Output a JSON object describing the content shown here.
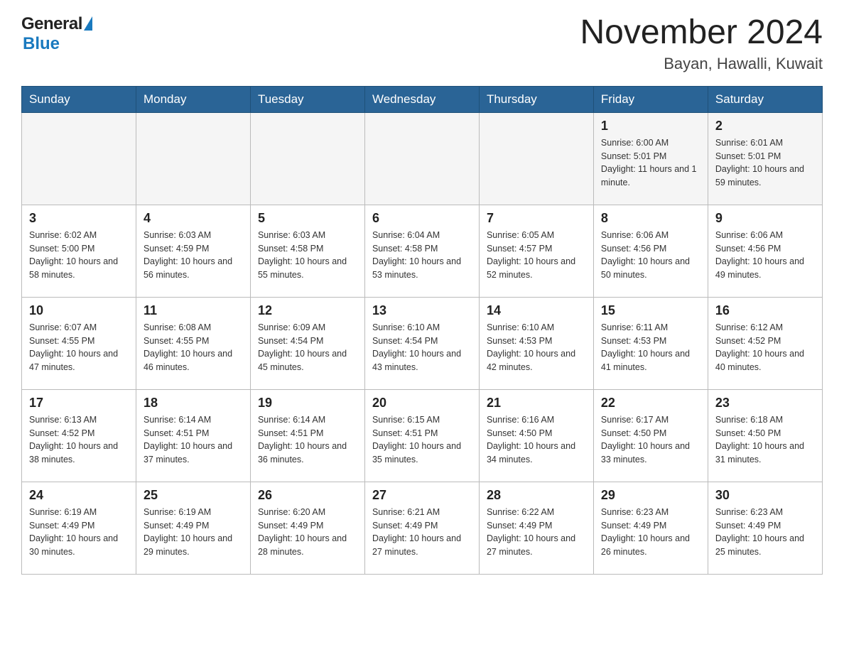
{
  "header": {
    "logo_general": "General",
    "logo_blue": "Blue",
    "title": "November 2024",
    "subtitle": "Bayan, Hawalli, Kuwait"
  },
  "weekdays": [
    "Sunday",
    "Monday",
    "Tuesday",
    "Wednesday",
    "Thursday",
    "Friday",
    "Saturday"
  ],
  "weeks": [
    [
      {
        "day": "",
        "info": ""
      },
      {
        "day": "",
        "info": ""
      },
      {
        "day": "",
        "info": ""
      },
      {
        "day": "",
        "info": ""
      },
      {
        "day": "",
        "info": ""
      },
      {
        "day": "1",
        "info": "Sunrise: 6:00 AM\nSunset: 5:01 PM\nDaylight: 11 hours and 1 minute."
      },
      {
        "day": "2",
        "info": "Sunrise: 6:01 AM\nSunset: 5:01 PM\nDaylight: 10 hours and 59 minutes."
      }
    ],
    [
      {
        "day": "3",
        "info": "Sunrise: 6:02 AM\nSunset: 5:00 PM\nDaylight: 10 hours and 58 minutes."
      },
      {
        "day": "4",
        "info": "Sunrise: 6:03 AM\nSunset: 4:59 PM\nDaylight: 10 hours and 56 minutes."
      },
      {
        "day": "5",
        "info": "Sunrise: 6:03 AM\nSunset: 4:58 PM\nDaylight: 10 hours and 55 minutes."
      },
      {
        "day": "6",
        "info": "Sunrise: 6:04 AM\nSunset: 4:58 PM\nDaylight: 10 hours and 53 minutes."
      },
      {
        "day": "7",
        "info": "Sunrise: 6:05 AM\nSunset: 4:57 PM\nDaylight: 10 hours and 52 minutes."
      },
      {
        "day": "8",
        "info": "Sunrise: 6:06 AM\nSunset: 4:56 PM\nDaylight: 10 hours and 50 minutes."
      },
      {
        "day": "9",
        "info": "Sunrise: 6:06 AM\nSunset: 4:56 PM\nDaylight: 10 hours and 49 minutes."
      }
    ],
    [
      {
        "day": "10",
        "info": "Sunrise: 6:07 AM\nSunset: 4:55 PM\nDaylight: 10 hours and 47 minutes."
      },
      {
        "day": "11",
        "info": "Sunrise: 6:08 AM\nSunset: 4:55 PM\nDaylight: 10 hours and 46 minutes."
      },
      {
        "day": "12",
        "info": "Sunrise: 6:09 AM\nSunset: 4:54 PM\nDaylight: 10 hours and 45 minutes."
      },
      {
        "day": "13",
        "info": "Sunrise: 6:10 AM\nSunset: 4:54 PM\nDaylight: 10 hours and 43 minutes."
      },
      {
        "day": "14",
        "info": "Sunrise: 6:10 AM\nSunset: 4:53 PM\nDaylight: 10 hours and 42 minutes."
      },
      {
        "day": "15",
        "info": "Sunrise: 6:11 AM\nSunset: 4:53 PM\nDaylight: 10 hours and 41 minutes."
      },
      {
        "day": "16",
        "info": "Sunrise: 6:12 AM\nSunset: 4:52 PM\nDaylight: 10 hours and 40 minutes."
      }
    ],
    [
      {
        "day": "17",
        "info": "Sunrise: 6:13 AM\nSunset: 4:52 PM\nDaylight: 10 hours and 38 minutes."
      },
      {
        "day": "18",
        "info": "Sunrise: 6:14 AM\nSunset: 4:51 PM\nDaylight: 10 hours and 37 minutes."
      },
      {
        "day": "19",
        "info": "Sunrise: 6:14 AM\nSunset: 4:51 PM\nDaylight: 10 hours and 36 minutes."
      },
      {
        "day": "20",
        "info": "Sunrise: 6:15 AM\nSunset: 4:51 PM\nDaylight: 10 hours and 35 minutes."
      },
      {
        "day": "21",
        "info": "Sunrise: 6:16 AM\nSunset: 4:50 PM\nDaylight: 10 hours and 34 minutes."
      },
      {
        "day": "22",
        "info": "Sunrise: 6:17 AM\nSunset: 4:50 PM\nDaylight: 10 hours and 33 minutes."
      },
      {
        "day": "23",
        "info": "Sunrise: 6:18 AM\nSunset: 4:50 PM\nDaylight: 10 hours and 31 minutes."
      }
    ],
    [
      {
        "day": "24",
        "info": "Sunrise: 6:19 AM\nSunset: 4:49 PM\nDaylight: 10 hours and 30 minutes."
      },
      {
        "day": "25",
        "info": "Sunrise: 6:19 AM\nSunset: 4:49 PM\nDaylight: 10 hours and 29 minutes."
      },
      {
        "day": "26",
        "info": "Sunrise: 6:20 AM\nSunset: 4:49 PM\nDaylight: 10 hours and 28 minutes."
      },
      {
        "day": "27",
        "info": "Sunrise: 6:21 AM\nSunset: 4:49 PM\nDaylight: 10 hours and 27 minutes."
      },
      {
        "day": "28",
        "info": "Sunrise: 6:22 AM\nSunset: 4:49 PM\nDaylight: 10 hours and 27 minutes."
      },
      {
        "day": "29",
        "info": "Sunrise: 6:23 AM\nSunset: 4:49 PM\nDaylight: 10 hours and 26 minutes."
      },
      {
        "day": "30",
        "info": "Sunrise: 6:23 AM\nSunset: 4:49 PM\nDaylight: 10 hours and 25 minutes."
      }
    ]
  ]
}
